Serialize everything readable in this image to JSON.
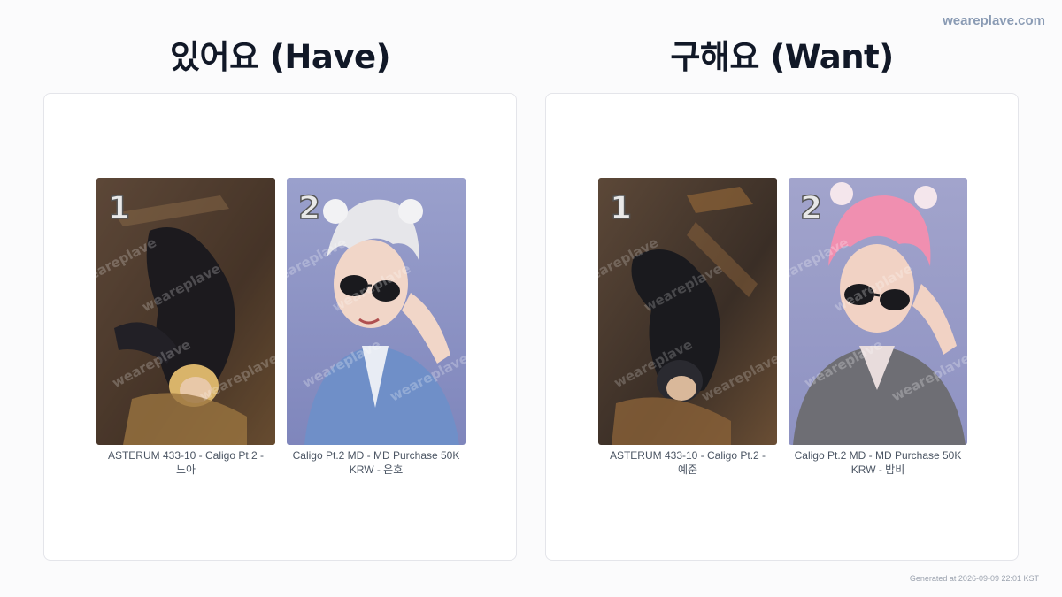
{
  "brand": "weareplave.com",
  "columns": [
    {
      "title": "있어요 (Have)",
      "cards": [
        {
          "number": "1",
          "caption_line1": "ASTERUM 433-10 - Caligo Pt.2 -",
          "caption_line2": "노아",
          "hair_color": "#d9b46a",
          "bg": "#5a4636"
        },
        {
          "number": "2",
          "caption_line1": "Caligo Pt.2 MD - MD Purchase 50K",
          "caption_line2": "KRW - 은호",
          "hair_color": "#e6e6ea",
          "bg": "#8e94c4"
        }
      ]
    },
    {
      "title": "구해요 (Want)",
      "cards": [
        {
          "number": "1",
          "caption_line1": "ASTERUM 433-10 - Caligo Pt.2 -",
          "caption_line2": "예준",
          "hair_color": "#2a2a30",
          "bg": "#4a3c30"
        },
        {
          "number": "2",
          "caption_line1": "Caligo Pt.2 MD - MD Purchase 50K",
          "caption_line2": "KRW - 밤비",
          "hair_color": "#f08fb0",
          "bg": "#9da0c8"
        }
      ]
    }
  ],
  "watermark_text": "weareplave",
  "footer": "Generated at 2026-09-09 22:01 KST"
}
